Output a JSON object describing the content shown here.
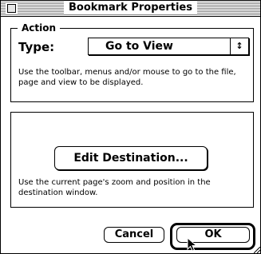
{
  "window": {
    "title": "Bookmark Properties"
  },
  "action": {
    "legend": "Action",
    "type_label": "Type:",
    "type_value": "Go to View",
    "popup_arrow_glyph": "↕",
    "help_text": "Use the toolbar, menus and/or mouse to go to the file, page and view to be displayed."
  },
  "destination": {
    "edit_button_label": "Edit Destination...",
    "help_text": "Use the current page's zoom and position in the destination window."
  },
  "buttons": {
    "cancel_label": "Cancel",
    "ok_label": "OK"
  },
  "icons": {
    "close_box": "close-box-icon",
    "popup_arrows": "up-down-arrows-icon",
    "cursor": "arrow-pointer-icon"
  }
}
